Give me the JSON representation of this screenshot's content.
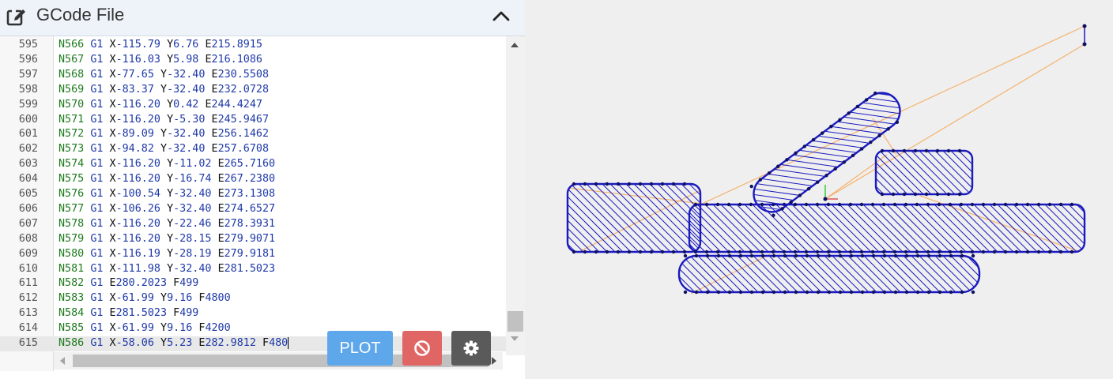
{
  "header": {
    "title": "GCode File",
    "edit_icon": "edit-icon",
    "collapse_icon": "chevron-up-icon"
  },
  "editor": {
    "lines": [
      {
        "num": "595",
        "n": "N566",
        "g": "G1",
        "args": [
          {
            "k": "X",
            "v": "-115.79"
          },
          {
            "k": "Y",
            "v": "6.76"
          },
          {
            "k": "E",
            "v": "215.8915"
          }
        ]
      },
      {
        "num": "596",
        "n": "N567",
        "g": "G1",
        "args": [
          {
            "k": "X",
            "v": "-116.03"
          },
          {
            "k": "Y",
            "v": "5.98"
          },
          {
            "k": "E",
            "v": "216.1086"
          }
        ]
      },
      {
        "num": "597",
        "n": "N568",
        "g": "G1",
        "args": [
          {
            "k": "X",
            "v": "-77.65"
          },
          {
            "k": "Y",
            "v": "-32.40"
          },
          {
            "k": "E",
            "v": "230.5508"
          }
        ]
      },
      {
        "num": "598",
        "n": "N569",
        "g": "G1",
        "args": [
          {
            "k": "X",
            "v": "-83.37"
          },
          {
            "k": "Y",
            "v": "-32.40"
          },
          {
            "k": "E",
            "v": "232.0728"
          }
        ]
      },
      {
        "num": "599",
        "n": "N570",
        "g": "G1",
        "args": [
          {
            "k": "X",
            "v": "-116.20"
          },
          {
            "k": "Y",
            "v": "0.42"
          },
          {
            "k": "E",
            "v": "244.4247"
          }
        ]
      },
      {
        "num": "600",
        "n": "N571",
        "g": "G1",
        "args": [
          {
            "k": "X",
            "v": "-116.20"
          },
          {
            "k": "Y",
            "v": "-5.30"
          },
          {
            "k": "E",
            "v": "245.9467"
          }
        ]
      },
      {
        "num": "601",
        "n": "N572",
        "g": "G1",
        "args": [
          {
            "k": "X",
            "v": "-89.09"
          },
          {
            "k": "Y",
            "v": "-32.40"
          },
          {
            "k": "E",
            "v": "256.1462"
          }
        ]
      },
      {
        "num": "602",
        "n": "N573",
        "g": "G1",
        "args": [
          {
            "k": "X",
            "v": "-94.82"
          },
          {
            "k": "Y",
            "v": "-32.40"
          },
          {
            "k": "E",
            "v": "257.6708"
          }
        ]
      },
      {
        "num": "603",
        "n": "N574",
        "g": "G1",
        "args": [
          {
            "k": "X",
            "v": "-116.20"
          },
          {
            "k": "Y",
            "v": "-11.02"
          },
          {
            "k": "E",
            "v": "265.7160"
          }
        ]
      },
      {
        "num": "604",
        "n": "N575",
        "g": "G1",
        "args": [
          {
            "k": "X",
            "v": "-116.20"
          },
          {
            "k": "Y",
            "v": "-16.74"
          },
          {
            "k": "E",
            "v": "267.2380"
          }
        ]
      },
      {
        "num": "605",
        "n": "N576",
        "g": "G1",
        "args": [
          {
            "k": "X",
            "v": "-100.54"
          },
          {
            "k": "Y",
            "v": "-32.40"
          },
          {
            "k": "E",
            "v": "273.1308"
          }
        ]
      },
      {
        "num": "606",
        "n": "N577",
        "g": "G1",
        "args": [
          {
            "k": "X",
            "v": "-106.26"
          },
          {
            "k": "Y",
            "v": "-32.40"
          },
          {
            "k": "E",
            "v": "274.6527"
          }
        ]
      },
      {
        "num": "607",
        "n": "N578",
        "g": "G1",
        "args": [
          {
            "k": "X",
            "v": "-116.20"
          },
          {
            "k": "Y",
            "v": "-22.46"
          },
          {
            "k": "E",
            "v": "278.3931"
          }
        ]
      },
      {
        "num": "608",
        "n": "N579",
        "g": "G1",
        "args": [
          {
            "k": "X",
            "v": "-116.20"
          },
          {
            "k": "Y",
            "v": "-28.15"
          },
          {
            "k": "E",
            "v": "279.9071"
          }
        ]
      },
      {
        "num": "609",
        "n": "N580",
        "g": "G1",
        "args": [
          {
            "k": "X",
            "v": "-116.19"
          },
          {
            "k": "Y",
            "v": "-28.19"
          },
          {
            "k": "E",
            "v": "279.9181"
          }
        ]
      },
      {
        "num": "610",
        "n": "N581",
        "g": "G1",
        "args": [
          {
            "k": "X",
            "v": "-111.98"
          },
          {
            "k": "Y",
            "v": "-32.40"
          },
          {
            "k": "E",
            "v": "281.5023"
          }
        ]
      },
      {
        "num": "611",
        "n": "N582",
        "g": "G1",
        "args": [
          {
            "k": "E",
            "v": "280.2023"
          },
          {
            "k": "F",
            "v": "499"
          }
        ]
      },
      {
        "num": "612",
        "n": "N583",
        "g": "G1",
        "args": [
          {
            "k": "X",
            "v": "-61.99"
          },
          {
            "k": "Y",
            "v": "9.16"
          },
          {
            "k": "F",
            "v": "4800"
          }
        ]
      },
      {
        "num": "613",
        "n": "N584",
        "g": "G1",
        "args": [
          {
            "k": "E",
            "v": "281.5023"
          },
          {
            "k": "F",
            "v": "499"
          }
        ]
      },
      {
        "num": "614",
        "n": "N585",
        "g": "G1",
        "args": [
          {
            "k": "X",
            "v": "-61.99"
          },
          {
            "k": "Y",
            "v": "9.16"
          },
          {
            "k": "F",
            "v": "4200"
          }
        ]
      },
      {
        "num": "615",
        "n": "N586",
        "g": "G1",
        "args": [
          {
            "k": "X",
            "v": "-58.06"
          },
          {
            "k": "Y",
            "v": "5.23"
          },
          {
            "k": "E",
            "v": "282.9812"
          },
          {
            "k": "F",
            "v": "480"
          }
        ]
      }
    ],
    "active_line": "615"
  },
  "toolbar": {
    "plot_label": "PLOT",
    "stop_icon": "ban-icon",
    "settings_icon": "gear-icon",
    "plot_color": "#5da7ea",
    "stop_color": "#e06666",
    "settings_color": "#5a5a5a"
  },
  "viewer": {
    "toolpath_color": "#1a1ac0",
    "travel_color": "#f5b26b",
    "background_color": "#efefef"
  }
}
